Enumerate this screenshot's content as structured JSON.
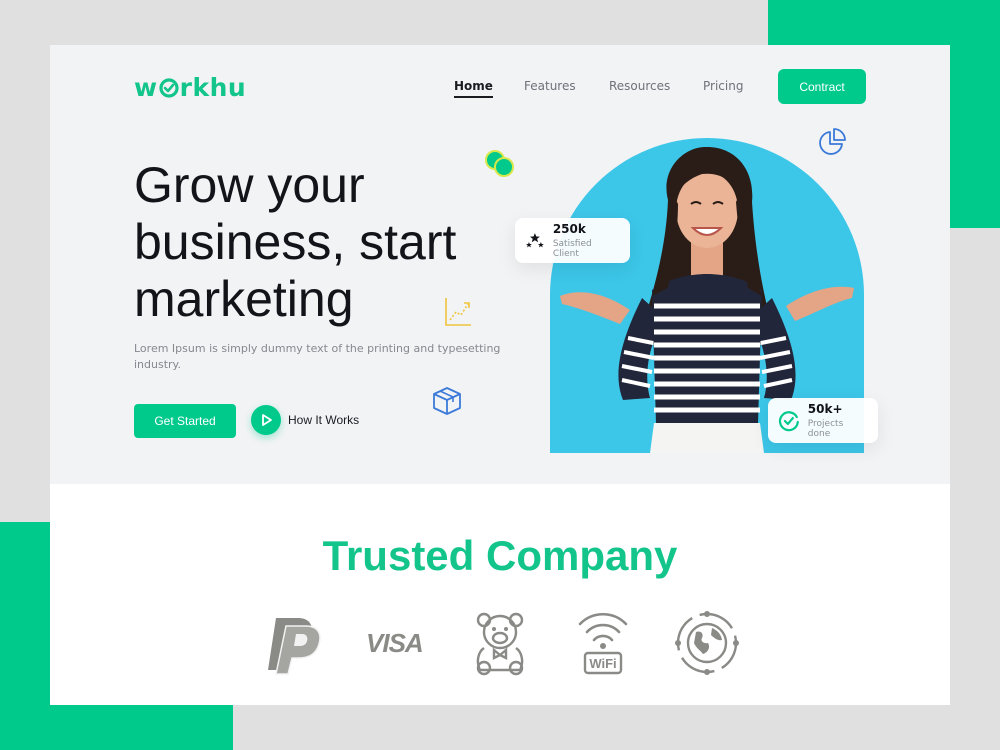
{
  "brand": {
    "logo_text_before": "w",
    "logo_text_after": "rkhu",
    "accent": "#00c98c",
    "arch_color": "#3cc6e8"
  },
  "nav": {
    "items": [
      {
        "label": "Home",
        "active": true
      },
      {
        "label": "Features",
        "active": false
      },
      {
        "label": "Resources",
        "active": false
      },
      {
        "label": "Pricing",
        "active": false
      }
    ],
    "cta_label": "Contract"
  },
  "hero": {
    "headline_line1": "Grow your",
    "headline_line2": "business, start",
    "headline_line3": "marketing",
    "description": "Lorem Ipsum is simply dummy text of the printing and typesetting industry.",
    "primary_button": "Get Started",
    "secondary_button": "How It Works"
  },
  "stats": {
    "clients_value": "250k",
    "clients_label": "Satisfied Client",
    "projects_value": "50k+",
    "projects_label": "Projects done"
  },
  "trusted": {
    "title": "Trusted Company",
    "logos": [
      "paypal-logo",
      "visa-logo",
      "teddy-bear-logo",
      "wifi-logo",
      "globe-logo"
    ],
    "visa_text": "VISA",
    "wifi_text": "WiFi"
  },
  "icons": [
    "check-icon",
    "play-icon",
    "chart-icon",
    "box-icon",
    "pie-chart-icon",
    "coins-icon",
    "stars-icon",
    "checkmark-circle-icon"
  ]
}
